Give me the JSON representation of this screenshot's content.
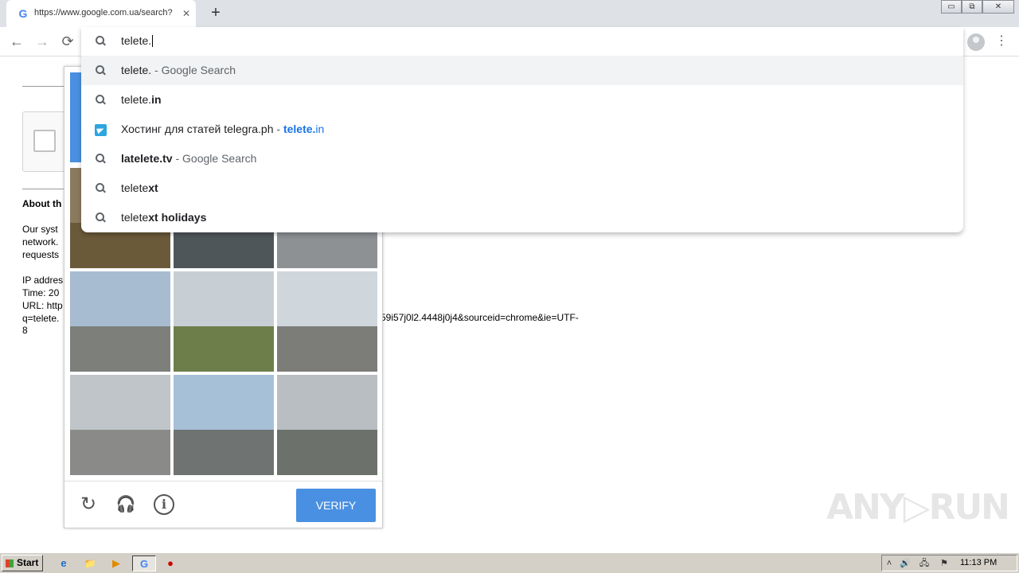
{
  "browser": {
    "tab": {
      "title": "https://www.google.com.ua/search?",
      "favicon": "G",
      "close": "✕"
    },
    "new_tab": "+",
    "window_controls": [
      "▭",
      "⧉",
      "✕"
    ]
  },
  "toolbar": {
    "back": "←",
    "forward": "→",
    "reload": "⟳",
    "menu": "⋮"
  },
  "omnibox": {
    "input": "telete.",
    "suggestions": [
      {
        "parts": [
          {
            "t": "telete.",
            "s": "normal"
          },
          {
            "t": " - Google Search",
            "s": "dim"
          }
        ],
        "icon": "search-icon",
        "selected": true
      },
      {
        "parts": [
          {
            "t": "telete.",
            "s": "normal"
          },
          {
            "t": "in",
            "s": "bold"
          }
        ],
        "icon": "search-icon",
        "selected": false
      },
      {
        "parts": [
          {
            "t": "Хостинг для статей telegra.ph",
            "s": "normal"
          },
          {
            "t": " - ",
            "s": "dim"
          },
          {
            "t": "telete.",
            "s": "urlbold"
          },
          {
            "t": "in",
            "s": "url"
          }
        ],
        "icon": "telegram-icon",
        "selected": false
      },
      {
        "parts": [
          {
            "t": "latelete.tv",
            "s": "bold"
          },
          {
            "t": " - Google Search",
            "s": "dim"
          }
        ],
        "icon": "search-icon",
        "selected": false
      },
      {
        "parts": [
          {
            "t": "telete",
            "s": "normal"
          },
          {
            "t": "xt",
            "s": "bold"
          }
        ],
        "icon": "search-icon",
        "selected": false
      },
      {
        "parts": [
          {
            "t": "telete",
            "s": "normal"
          },
          {
            "t": "xt holidays",
            "s": "bold"
          }
        ],
        "icon": "search-icon",
        "selected": false
      }
    ]
  },
  "page": {
    "about_heading": "About th",
    "paragraph": [
      "Our syst",
      "network.",
      "requests"
    ],
    "details": [
      "IP addres",
      "Time: 20",
      "URL: http",
      "q=telete."
    ],
    "url_tail": "59i57j0l2.4448j0j4&sourceid=chrome&ie=UTF-",
    "url_end": "8"
  },
  "captcha": {
    "verify_label": "VERIFY",
    "reload_glyph": "↻",
    "audio_glyph": "🎧",
    "info_glyph": "i",
    "tiles": [
      {
        "sky": "#8c7a5e",
        "ground": "#6b5a3a"
      },
      {
        "sky": "#7d8a92",
        "ground": "#4f5659"
      },
      {
        "sky": "#a9aeb2",
        "ground": "#8d9194"
      },
      {
        "sky": "#a7bcd0",
        "ground": "#7c7f7a"
      },
      {
        "sky": "#c8cfd4",
        "ground": "#6d7e4a"
      },
      {
        "sky": "#cfd6dc",
        "ground": "#7c7c78"
      },
      {
        "sky": "#bfc5c9",
        "ground": "#8a8b88"
      },
      {
        "sky": "#a6c0d8",
        "ground": "#6f7472"
      },
      {
        "sky": "#b9bec2",
        "ground": "#6c716b"
      }
    ]
  },
  "watermark": "ANY▷RUN",
  "taskbar": {
    "start_label": "Start",
    "items": [
      "e",
      "📁",
      "▶",
      "G",
      "●"
    ],
    "clock": "11:13 PM",
    "tray": [
      "˄",
      "🔊",
      "🖧",
      "⚑"
    ]
  }
}
